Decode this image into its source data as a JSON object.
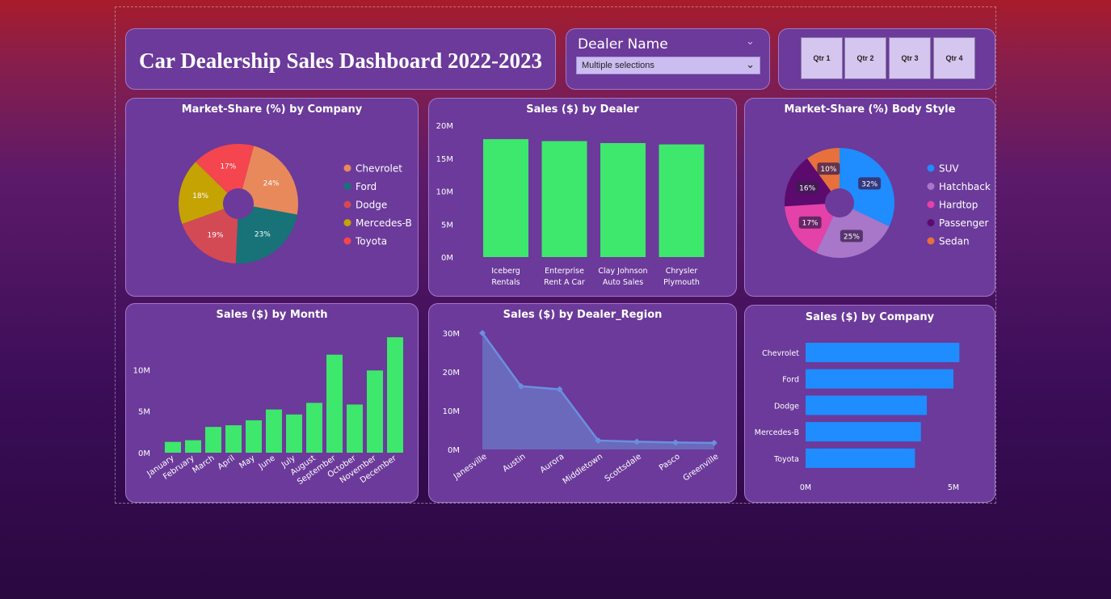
{
  "dashboard": {
    "title": "Car Dealership Sales Dashboard 2022-2023"
  },
  "slicer": {
    "label": "Dealer Name",
    "value": "Multiple selections"
  },
  "quarters": [
    "Qtr 1",
    "Qtr 2",
    "Qtr 3",
    "Qtr 4"
  ],
  "colors": {
    "bar_green": "#3de86c",
    "bar_blue": "#1f8cff",
    "line": "#6a8fe0",
    "area": "#6b6fc0",
    "card": "#6b3a9a"
  },
  "chart_data": [
    {
      "id": "company_share",
      "type": "pie",
      "title": "Market-Share (%) by Company",
      "labels": [
        "Chevrolet",
        "Ford",
        "Dodge",
        "Mercedes-B",
        "Toyota"
      ],
      "values": [
        24,
        23,
        19,
        18,
        17
      ],
      "colors": [
        "#e8895c",
        "#177377",
        "#d34a55",
        "#c4a302",
        "#f5454e"
      ],
      "legend": "right"
    },
    {
      "id": "dealer_sales",
      "type": "bar",
      "title": "Sales ($) by Dealer",
      "categories": [
        [
          "Iceberg",
          "Rentals"
        ],
        [
          "Enterprise",
          "Rent A Car"
        ],
        [
          "Clay Johnson",
          "Auto Sales"
        ],
        [
          "Chrysler",
          "Plymouth"
        ]
      ],
      "values": [
        17.9,
        17.6,
        17.3,
        17.1
      ],
      "yticks": [
        "0M",
        "5M",
        "10M",
        "15M",
        "20M"
      ],
      "ylim": [
        0,
        20
      ]
    },
    {
      "id": "body_share",
      "type": "pie",
      "title": "Market-Share (%) Body Style",
      "labels": [
        "SUV",
        "Hatchback",
        "Hardtop",
        "Passenger",
        "Sedan"
      ],
      "values": [
        32,
        25,
        17,
        16,
        10
      ],
      "colors": [
        "#1f8cff",
        "#a877c9",
        "#e442a8",
        "#5c0a6e",
        "#e8703c"
      ],
      "legend": "right"
    },
    {
      "id": "month_sales",
      "type": "bar",
      "title": "Sales ($) by Month",
      "categories": [
        "January",
        "February",
        "March",
        "April",
        "May",
        "June",
        "July",
        "August",
        "September",
        "October",
        "November",
        "December"
      ],
      "values": [
        1.3,
        1.5,
        3.1,
        3.3,
        3.9,
        5.2,
        4.6,
        6.0,
        11.8,
        5.8,
        9.9,
        13.9
      ],
      "yticks": [
        "0M",
        "5M",
        "10M"
      ],
      "ylim": [
        0,
        14.6
      ]
    },
    {
      "id": "region_sales",
      "type": "area",
      "title": "Sales ($) by Dealer_Region",
      "categories": [
        "Janesville",
        "Austin",
        "Aurora",
        "Middletown",
        "Scottsdale",
        "Pasco",
        "Greenville"
      ],
      "values": [
        30.0,
        16.3,
        15.5,
        2.3,
        2.0,
        1.8,
        1.7
      ],
      "yticks": [
        "0M",
        "10M",
        "20M",
        "30M"
      ],
      "ylim": [
        0,
        30
      ]
    },
    {
      "id": "company_sales",
      "type": "bar",
      "orientation": "horizontal",
      "title": "Sales ($) by Company",
      "categories": [
        "Chevrolet",
        "Ford",
        "Dodge",
        "Mercedes-B",
        "Toyota"
      ],
      "values": [
        5.2,
        5.0,
        4.1,
        3.9,
        3.7
      ],
      "xticks": [
        "0M",
        "5M"
      ],
      "xlim": [
        0,
        5
      ]
    }
  ]
}
